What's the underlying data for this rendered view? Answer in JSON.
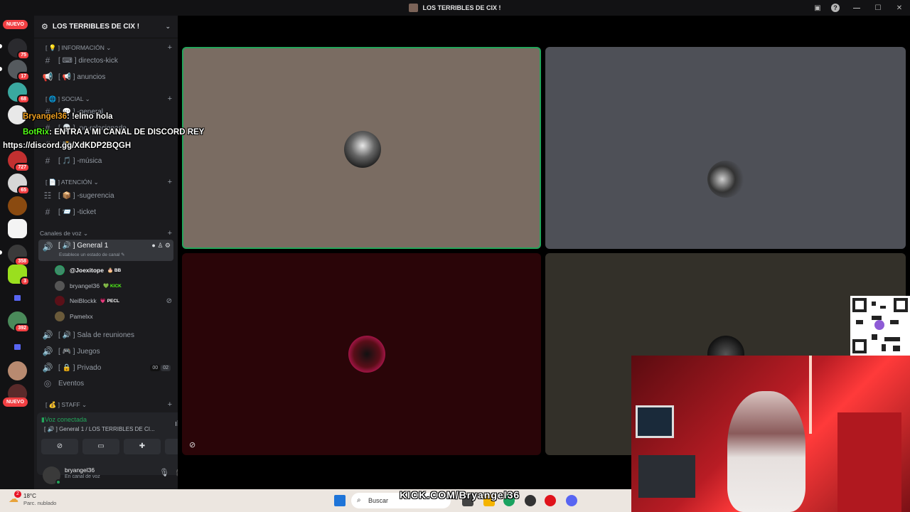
{
  "window": {
    "title": "LOS TERRIBLES DE CIX !",
    "help": "?",
    "min": "—",
    "max": "☐",
    "close": "✕"
  },
  "servers": {
    "nuevo_top": "NUEVO",
    "nuevo_bottom": "NUEVO",
    "badges": [
      "75",
      "17",
      "68",
      "727",
      "65",
      "358",
      "3",
      "392"
    ]
  },
  "sidebar": {
    "server_name": "LOS TERRIBLES DE CIX !",
    "categories": [
      {
        "label": "[ 💡 ] INFORMACIÓN ⌄"
      },
      {
        "label": "[ 🌐 ] SOCIAL ⌄"
      },
      {
        "label": "[ 📄 ] ATENCIÓN ⌄"
      },
      {
        "label": "Canales de voz ⌄"
      },
      {
        "label": "[ 💰 ] STAFF ⌄"
      }
    ],
    "channels": [
      {
        "label": "[ ⌨ ] directos-kick"
      },
      {
        "label": "[ 📢 ] anuncios"
      },
      {
        "label": "[ 💬 ] -general"
      },
      {
        "label": "[ 💀 ] -no-relacionado"
      },
      {
        "label": "[ 📸 ] -clips"
      },
      {
        "label": "[ 🎵 ] -música"
      },
      {
        "label": "[ 📦 ] -sugerencia"
      },
      {
        "label": "[ 📨 ] -ticket"
      }
    ],
    "voice_active": {
      "label": "[ 🔊 ] General 1",
      "sub": "Establece un estado de canal ✎"
    },
    "voice_users": [
      {
        "name": "@Joexitope",
        "tag": "🎂 BB",
        "tag_color": "#f2f3f5"
      },
      {
        "name": "bryangel36",
        "tag": "💚 KICK",
        "tag_color": "#53fc18"
      },
      {
        "name": "NeiBlockk",
        "tag": "💗 PECL",
        "tag_color": "#f2f3f5"
      },
      {
        "name": "Pamelxx",
        "tag": "",
        "tag_color": "#f2f3f5"
      }
    ],
    "voice_channels": [
      {
        "label": "[ 🔊 ] Sala de reuniones"
      },
      {
        "label": "[ 🎮 ] Juegos"
      },
      {
        "label": "[ 🔒 ] Privado",
        "counter_a": "00",
        "counter_b": "02"
      }
    ],
    "events": "Eventos"
  },
  "voice_panel": {
    "status": "Voz conectada",
    "where": "[ 🔊 ] General 1 / LOS TERRIBLES DE CI..."
  },
  "user": {
    "name": "bryangel36",
    "status": "En canal de voz"
  },
  "overlay": {
    "chat1_user": "Bryangel36",
    "chat1_text": ": !elmo hola",
    "chat2_user": "BotRix",
    "chat2_text": ": ENTRA A MI CANAL DE DISCORD REY",
    "chat2_link": "https://discord.gg/XdKDP2BQGH"
  },
  "taskbar": {
    "temp": "18°C",
    "weather": "Parc. nublado",
    "search": "Buscar",
    "kick_url": "KICK.COM/Bryangel36",
    "weather_badge": "2"
  },
  "colors": {
    "accent": "#5865f2",
    "online": "#23a55a",
    "danger": "#f23f42",
    "kick": "#53fc18"
  }
}
